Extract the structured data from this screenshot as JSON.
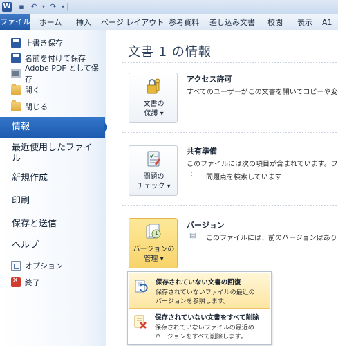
{
  "quick_access": {
    "app_icon_text": "W",
    "save_icon": "save-icon",
    "undo_icon": "undo-icon",
    "redo_icon": "redo-icon",
    "separator": "|",
    "customize_icon": "chevron-down-icon"
  },
  "ribbon": {
    "tabs": [
      {
        "label": "ファイル"
      },
      {
        "label": "ホーム"
      },
      {
        "label": "挿入"
      },
      {
        "label": "ページ レイアウト"
      },
      {
        "label": "参考資料"
      },
      {
        "label": "差し込み文書"
      },
      {
        "label": "校閲"
      },
      {
        "label": "表示"
      },
      {
        "label": "A1"
      }
    ]
  },
  "backstage_nav": {
    "commands": [
      {
        "label": "上書き保存",
        "icon": "save-icon"
      },
      {
        "label": "名前を付けて保存",
        "icon": "save-as-icon"
      },
      {
        "label": "Adobe PDF として保存",
        "icon": "pdf-icon"
      },
      {
        "label": "開く",
        "icon": "folder-open-icon"
      },
      {
        "label": "閉じる",
        "icon": "folder-close-icon"
      }
    ],
    "tabs": [
      {
        "label": "情報",
        "active": true
      },
      {
        "label": "最近使用したファイ",
        "label2": "ル"
      },
      {
        "label": "新規作成"
      },
      {
        "label": "印刷"
      },
      {
        "label": "保存と送信"
      },
      {
        "label": "ヘルプ"
      }
    ],
    "bottom_commands": [
      {
        "label": "オプション",
        "icon": "options-icon"
      },
      {
        "label": "終了",
        "icon": "exit-icon"
      }
    ]
  },
  "info": {
    "title": "文書 1 の情報",
    "permissions": {
      "button_line1": "文書の",
      "button_line2": "保護 ▾",
      "heading": "アクセス許可",
      "text": "すべてのユーザーがこの文書を開いてコピーや変更"
    },
    "prepare": {
      "button_line1": "問題の",
      "button_line2": "チェック ▾",
      "heading": "共有準備",
      "text": "このファイルには次の項目が含まれています。ファイル",
      "status": "問題点を検索しています"
    },
    "versions": {
      "button_line1": "バージョンの",
      "button_line2": "管理 ▾",
      "heading": "バージョン",
      "text": "このファイルには、前のバージョンはありませ"
    }
  },
  "version_menu": {
    "items": [
      {
        "title": "保存されていない文書の回復",
        "desc1": "保存されていないファイルの最近の",
        "desc2": "バージョンを参照します。",
        "icon": "recover-document-icon"
      },
      {
        "title": "保存されていない文書をすべて削除",
        "desc1": "保存されていないファイルの最近の",
        "desc2": "バージョンをすべて削除します。",
        "icon": "delete-documents-icon"
      }
    ]
  },
  "colors": {
    "file_tab": "#2a66b8",
    "nav_active": "#2a6ac0",
    "highlight": "#f8d36a"
  }
}
